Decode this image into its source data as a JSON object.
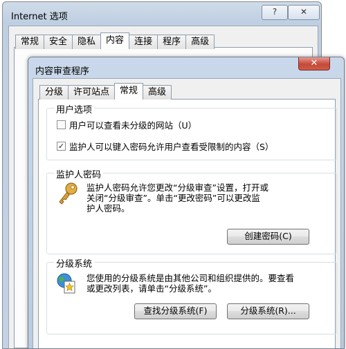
{
  "background_window": {
    "title": "Internet 选项",
    "help_label": "?",
    "close_label": "✕",
    "tabs": [
      "常规",
      "安全",
      "隐私",
      "内容",
      "连接",
      "程序",
      "高级"
    ],
    "selected_tab": "内容"
  },
  "dialog": {
    "title": "内容审查程序",
    "close_label": "✕",
    "tabs": [
      "分级",
      "许可站点",
      "常规",
      "高级"
    ],
    "selected_tab": "常规",
    "user_options": {
      "label": "用户选项",
      "option1": {
        "label": "用户可以查看未分级的网站（U）",
        "checked": false
      },
      "option2": {
        "label": "监护人可以键入密码允许用户查看受限制的内容（S）",
        "checked": true
      }
    },
    "supervisor_password": {
      "label": "监护人密码",
      "icon": "key-icon",
      "description_lines": [
        "监护人密码允许您更改“分级审查”设置，打开或",
        "关闭“分级审查”。单击“更改密码”可以更改监",
        "护人密码。"
      ],
      "create_button": "创建密码(C)"
    },
    "rating_systems": {
      "label": "分级系统",
      "icon": "rating-system-icon",
      "description_lines": [
        "您使用的分级系统是由其他公司和组织提供的。要查看",
        "或更改列表，请单击“分级系统”。"
      ],
      "find_button": "查找分级系统(F)",
      "systems_button": "分级系统(R)..."
    }
  },
  "colors": {
    "check_mark": "#222222",
    "key_gold": "#d8a23a",
    "close_red": "#c44a3a"
  }
}
